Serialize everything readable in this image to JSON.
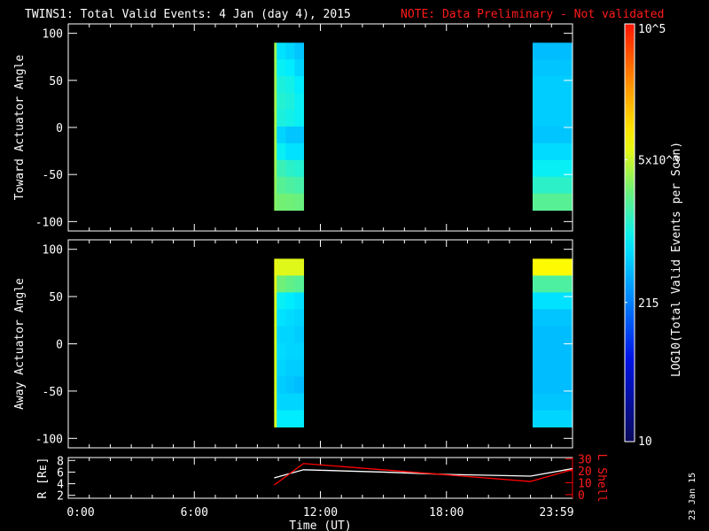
{
  "title": "TWINS1: Total Valid Events:  4 Jan (day   4), 2015",
  "note": "NOTE: Data Preliminary - Not validated",
  "date_stamp": "23 Jan 15",
  "colors": {
    "note": "#ff1a1a",
    "axes": "#ffffff",
    "lshell": "#ff0000",
    "radius": "#ffffff"
  },
  "chart_data": [
    {
      "type": "heatmap",
      "ylabel": "Toward Actuator Angle",
      "ylim": [
        -110,
        110
      ],
      "yticks": [
        "100",
        "50",
        "0",
        "-50",
        "-100"
      ],
      "ytick_values": [
        100,
        50,
        0,
        -50,
        -100
      ],
      "angle_range": [
        -88,
        90
      ],
      "blocks": [
        {
          "time_hours": [
            9.8,
            11.2
          ],
          "values": [
            [
              3500,
              700,
              600,
              500
            ],
            [
              3500,
              900,
              800,
              600
            ],
            [
              3600,
              1100,
              1000,
              800
            ],
            [
              3700,
              1200,
              1100,
              900
            ],
            [
              3800,
              1100,
              1000,
              900
            ],
            [
              3800,
              600,
              500,
              500
            ],
            [
              3800,
              900,
              700,
              700
            ],
            [
              3500,
              1500,
              1300,
              1200
            ],
            [
              3200,
              2000,
              1800,
              1700
            ],
            [
              3000,
              2600,
              2500,
              2400
            ]
          ]
        },
        {
          "time_hours": [
            22.1,
            24.0
          ],
          "values": [
            [
              450,
              450,
              450,
              450
            ],
            [
              500,
              500,
              500,
              500
            ],
            [
              550,
              550,
              550,
              550
            ],
            [
              550,
              550,
              550,
              550
            ],
            [
              550,
              550,
              550,
              550
            ],
            [
              500,
              500,
              500,
              500
            ],
            [
              650,
              650,
              650,
              650
            ],
            [
              900,
              900,
              900,
              900
            ],
            [
              1300,
              1300,
              1300,
              1300
            ],
            [
              2000,
              2000,
              2000,
              2000
            ]
          ]
        }
      ]
    },
    {
      "type": "heatmap",
      "ylabel": "Away Actuator Angle",
      "ylim": [
        -110,
        110
      ],
      "yticks": [
        "100",
        "50",
        "0",
        "-50",
        "-100"
      ],
      "ytick_values": [
        100,
        50,
        0,
        -50,
        -100
      ],
      "angle_range": [
        -88,
        90
      ],
      "blocks": [
        {
          "time_hours": [
            9.8,
            11.2
          ],
          "values": [
            [
              6500,
              6000,
              6000,
              6000
            ],
            [
              6000,
              2500,
              2200,
              2000
            ],
            [
              5500,
              900,
              800,
              700
            ],
            [
              5500,
              700,
              650,
              600
            ],
            [
              5500,
              600,
              600,
              550
            ],
            [
              5500,
              650,
              600,
              600
            ],
            [
              5500,
              600,
              550,
              550
            ],
            [
              5500,
              550,
              500,
              450
            ],
            [
              5500,
              600,
              600,
              600
            ],
            [
              5500,
              800,
              800,
              800
            ]
          ]
        },
        {
          "time_hours": [
            22.1,
            24.0
          ],
          "values": [
            [
              7500,
              7500,
              7500,
              7500
            ],
            [
              1800,
              1800,
              1800,
              1800
            ],
            [
              700,
              700,
              700,
              700
            ],
            [
              500,
              500,
              500,
              500
            ],
            [
              450,
              450,
              450,
              450
            ],
            [
              450,
              450,
              450,
              450
            ],
            [
              450,
              450,
              450,
              450
            ],
            [
              450,
              450,
              450,
              450
            ],
            [
              500,
              500,
              500,
              500
            ],
            [
              600,
              600,
              600,
              600
            ]
          ]
        }
      ]
    },
    {
      "type": "line",
      "xlabel": "Time (UT)",
      "xticks": [
        "0:00",
        "6:00",
        "12:00",
        "18:00",
        "23:59"
      ],
      "xtick_hours": [
        0,
        6,
        12,
        18,
        24
      ],
      "xlim": [
        0,
        24
      ],
      "ylabel": "R [Rᴇ]",
      "ylim": [
        1.5,
        8.5
      ],
      "yticks": [
        "2",
        "4",
        "6",
        "8"
      ],
      "ylabel2": "L Shell",
      "ylim2": [
        -3,
        31
      ],
      "yticks2": [
        "0",
        "10",
        "20",
        "30"
      ],
      "series": [
        {
          "name": "R",
          "axis": "left",
          "x": [
            9.8,
            11.2,
            15.0,
            18.0,
            22.0,
            24.0
          ],
          "y": [
            5.0,
            6.4,
            6.0,
            5.6,
            5.3,
            6.6
          ]
        },
        {
          "name": "L Shell",
          "axis": "right",
          "x": [
            9.8,
            11.2,
            22.0,
            24.0
          ],
          "y": [
            8,
            26,
            11,
            21
          ]
        }
      ]
    }
  ],
  "colorbar": {
    "label": "LOG10(Total Valid Events per Scan)",
    "range": [
      10,
      100000
    ],
    "ticks": [
      {
        "value": 100000,
        "label": "10^5"
      },
      {
        "value": 5000,
        "label": "5x10^3"
      },
      {
        "value": 215,
        "label": "215"
      },
      {
        "value": 10,
        "label": "10"
      }
    ]
  }
}
